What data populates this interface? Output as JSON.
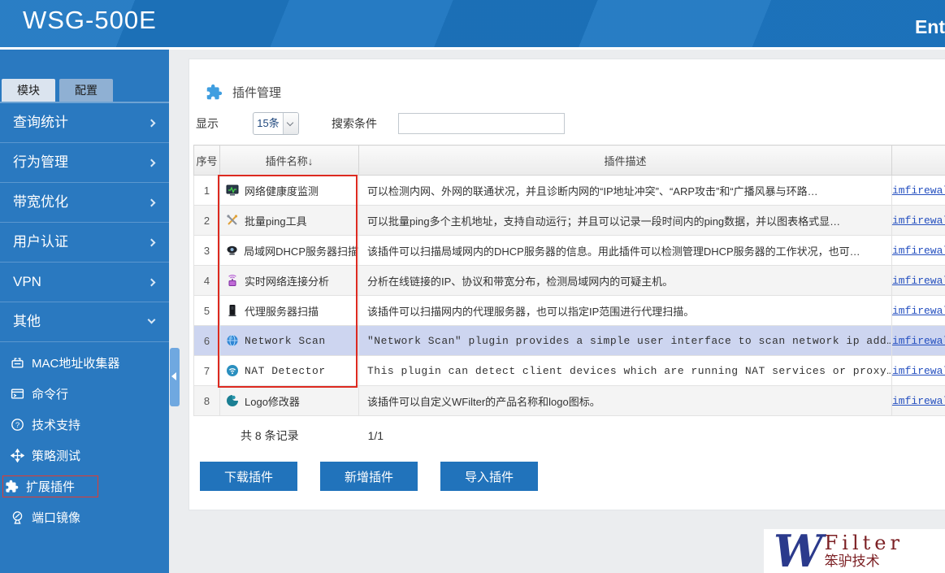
{
  "topbar": {
    "title": "WSG-500E",
    "right_text": "Ent"
  },
  "sidebar": {
    "tabs": [
      {
        "label": "模块"
      },
      {
        "label": "配置"
      }
    ],
    "menu": [
      {
        "label": "查询统计"
      },
      {
        "label": "行为管理"
      },
      {
        "label": "带宽优化"
      },
      {
        "label": "用户认证"
      },
      {
        "label": "VPN"
      },
      {
        "label": "其他"
      }
    ],
    "submenu": [
      {
        "label": "MAC地址收集器"
      },
      {
        "label": "命令行"
      },
      {
        "label": "技术支持"
      },
      {
        "label": "策略测试"
      },
      {
        "label": "扩展插件"
      },
      {
        "label": "端口镜像"
      }
    ]
  },
  "main": {
    "title": "插件管理",
    "display_label": "显示",
    "page_size": "15条",
    "search_label": "搜索条件",
    "search_value": "",
    "table": {
      "headers": [
        "序号",
        "插件名称↓",
        "插件描述",
        ""
      ],
      "rows": [
        {
          "no": "1",
          "name": "网络健康度监测",
          "desc": "可以检测内网、外网的联通状况，并且诊断内网的“IP地址冲突”、“ARP攻击”和“广播风暴与环路…",
          "link": "imfirewall"
        },
        {
          "no": "2",
          "name": "批量ping工具",
          "desc": "可以批量ping多个主机地址，支持自动运行；并且可以记录一段时间内的ping数据，并以图表格式显…",
          "link": "imfirewall"
        },
        {
          "no": "3",
          "name": "局域网DHCP服务器扫描",
          "desc": "该插件可以扫描局域网内的DHCP服务器的信息。用此插件可以检测管理DHCP服务器的工作状况，也可…",
          "link": "imfirewall"
        },
        {
          "no": "4",
          "name": "实时网络连接分析",
          "desc": "分析在线链接的IP、协议和带宽分布，检测局域网内的可疑主机。",
          "link": "imfirewall"
        },
        {
          "no": "5",
          "name": "代理服务器扫描",
          "desc": "该插件可以扫描网内的代理服务器，也可以指定IP范围进行代理扫描。",
          "link": "imfirewall"
        },
        {
          "no": "6",
          "name": "Network Scan",
          "desc": "\"Network Scan\" plugin provides a simple user interface to scan network ip add…",
          "link": "imfirewall"
        },
        {
          "no": "7",
          "name": "NAT Detector",
          "desc": "This plugin can detect client devices which are running NAT services or proxy…",
          "link": "imfirewall"
        },
        {
          "no": "8",
          "name": "Logo修改器",
          "desc": "该插件可以自定义WFilter的产品名称和logo图标。",
          "link": "imfirewall"
        }
      ]
    },
    "footer": {
      "total": "共 8 条记录",
      "page": "1/1"
    },
    "buttons": [
      {
        "label": "下载插件"
      },
      {
        "label": "新增插件"
      },
      {
        "label": "导入插件"
      }
    ]
  },
  "logo": {
    "w": "W",
    "name": "Filter",
    "sub": "笨驴技术"
  }
}
